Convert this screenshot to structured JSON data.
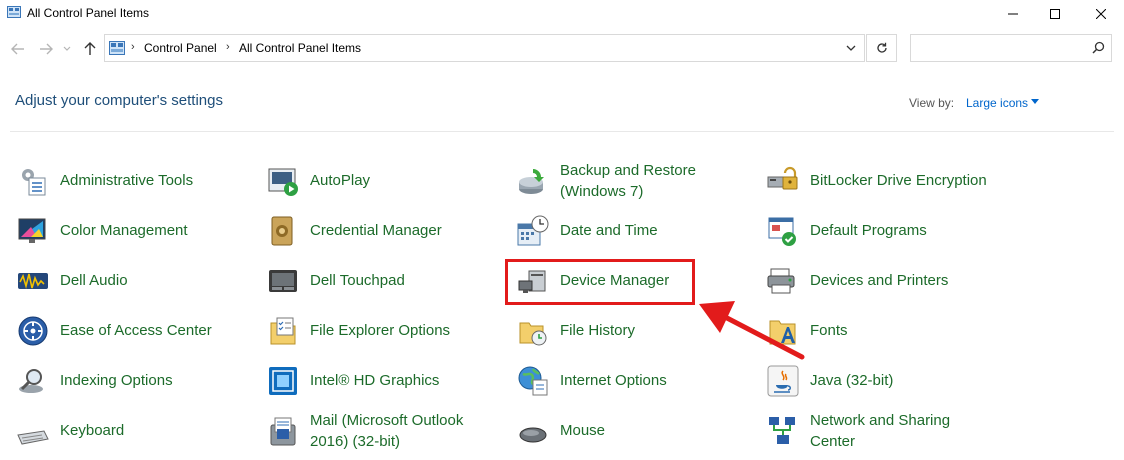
{
  "window": {
    "title": "All Control Panel Items",
    "controls": {
      "minimize_icon": "minimize-icon",
      "maximize_icon": "maximize-icon",
      "close_icon": "close-icon"
    }
  },
  "navigation": {
    "back_icon": "back-arrow-icon",
    "forward_icon": "forward-arrow-icon",
    "recent_icon": "chevron-down-icon",
    "up_icon": "up-arrow-icon"
  },
  "address": {
    "breadcrumbs": [
      "Control Panel",
      "All Control Panel Items"
    ],
    "separator": "›"
  },
  "search": {
    "placeholder": "",
    "value": ""
  },
  "header": {
    "title": "Adjust your computer's settings",
    "view_by_label": "View by:",
    "view_by_value": "Large icons"
  },
  "items": [
    {
      "label": "Administrative Tools",
      "icon": "administrative-tools-icon"
    },
    {
      "label": "AutoPlay",
      "icon": "autoplay-icon"
    },
    {
      "label": "Backup and Restore",
      "label2": "(Windows 7)",
      "icon": "backup-restore-icon"
    },
    {
      "label": "BitLocker Drive Encryption",
      "icon": "bitlocker-icon"
    },
    {
      "label": "Color Management",
      "icon": "color-management-icon"
    },
    {
      "label": "Credential Manager",
      "icon": "credential-manager-icon"
    },
    {
      "label": "Date and Time",
      "icon": "date-time-icon"
    },
    {
      "label": "Default Programs",
      "icon": "default-programs-icon"
    },
    {
      "label": "Dell Audio",
      "icon": "dell-audio-icon"
    },
    {
      "label": "Dell Touchpad",
      "icon": "dell-touchpad-icon"
    },
    {
      "label": "Device Manager",
      "icon": "device-manager-icon"
    },
    {
      "label": "Devices and Printers",
      "icon": "devices-printers-icon"
    },
    {
      "label": "Ease of Access Center",
      "icon": "ease-of-access-icon"
    },
    {
      "label": "File Explorer Options",
      "icon": "file-explorer-options-icon"
    },
    {
      "label": "File History",
      "icon": "file-history-icon"
    },
    {
      "label": "Fonts",
      "icon": "fonts-icon"
    },
    {
      "label": "Indexing Options",
      "icon": "indexing-options-icon"
    },
    {
      "label": "Intel® HD Graphics",
      "icon": "intel-graphics-icon"
    },
    {
      "label": "Internet Options",
      "icon": "internet-options-icon"
    },
    {
      "label": "Java (32-bit)",
      "icon": "java-icon"
    },
    {
      "label": "Keyboard",
      "icon": "keyboard-icon"
    },
    {
      "label": "Mail (Microsoft Outlook",
      "label2": "2016) (32-bit)",
      "icon": "mail-icon"
    },
    {
      "label": "Mouse",
      "icon": "mouse-icon"
    },
    {
      "label": "Network and Sharing",
      "label2": "Center",
      "icon": "network-sharing-icon"
    }
  ],
  "annotation": {
    "highlighted_item": "Device Manager",
    "color": "#e21b1b"
  },
  "colors": {
    "link_green": "#1c6b2a",
    "heading_blue": "#1e4e79",
    "accent_blue": "#0066cc"
  }
}
